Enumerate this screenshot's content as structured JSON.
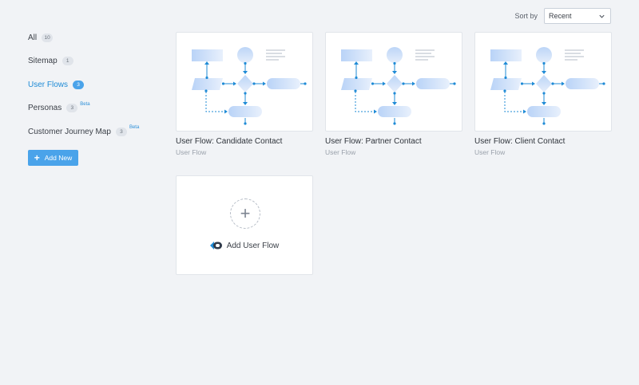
{
  "sort": {
    "label": "Sort by",
    "value": "Recent"
  },
  "sidebar": {
    "items": [
      {
        "label": "All",
        "count": "10",
        "beta": ""
      },
      {
        "label": "Sitemap",
        "count": "1",
        "beta": ""
      },
      {
        "label": "User Flows",
        "count": "3",
        "beta": "",
        "active": true
      },
      {
        "label": "Personas",
        "count": "3",
        "beta": "Beta"
      },
      {
        "label": "Customer Journey Map",
        "count": "3",
        "beta": "Beta"
      }
    ],
    "add_new": "Add New"
  },
  "cards": [
    {
      "title": "User Flow: Candidate Contact",
      "type": "User Flow"
    },
    {
      "title": "User Flow: Partner Contact",
      "type": "User Flow"
    },
    {
      "title": "User Flow: Client Contact",
      "type": "User Flow"
    }
  ],
  "add_card": {
    "label": "Add User Flow"
  },
  "colors": {
    "accent": "#4aa3ea",
    "active_text": "#1f8bd6",
    "flow_line": "#1f8bd6"
  }
}
